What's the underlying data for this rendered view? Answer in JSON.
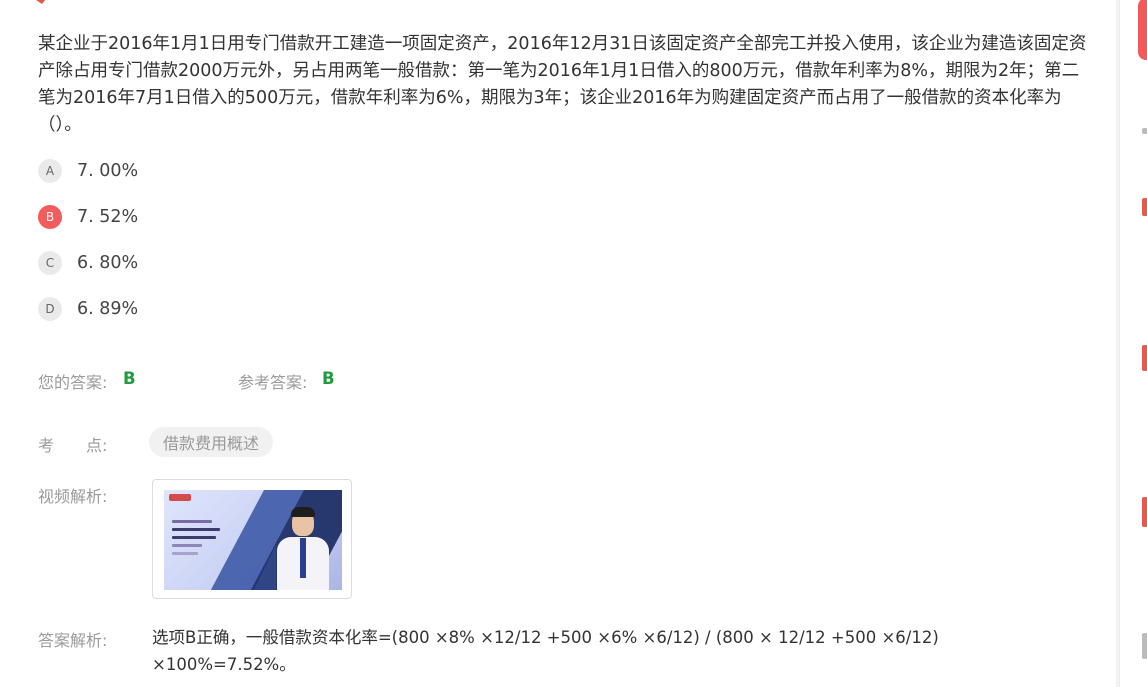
{
  "question": {
    "text": "某企业于2016年1月1日用专门借款开工建造一项固定资产，2016年12月31日该固定资产全部完工并投入使用，该企业为建造该固定资产除占用专门借款2000万元外，另占用两笔一般借款：第一笔为2016年1月1日借入的800万元，借款年利率为8%，期限为2年；第二笔为2016年7月1日借入的500万元，借款年利率为6%，期限为3年；该企业2016年为购建固定资产而占用了一般借款的资本化率为（）。"
  },
  "options": [
    {
      "letter": "A",
      "text": "7. 00%",
      "selected": false
    },
    {
      "letter": "B",
      "text": "7. 52%",
      "selected": true
    },
    {
      "letter": "C",
      "text": "6. 80%",
      "selected": false
    },
    {
      "letter": "D",
      "text": "6. 89%",
      "selected": false
    }
  ],
  "answer": {
    "your_label": "您的答案:",
    "your_value": "B",
    "ref_label": "参考答案:",
    "ref_value": "B"
  },
  "knowledge": {
    "label": "考　　点:",
    "tag": "借款费用概述"
  },
  "video": {
    "label": "视频解析:"
  },
  "explanation": {
    "label": "答案解析:",
    "text": "选项B正确，一般借款资本化率=(800 ×8% ×12/12 +500 ×6% ×6/12) / (800 × 12/12 +500 ×6/12) ×100%=7.52%。"
  },
  "colors": {
    "accent_red": "#f25c5c",
    "answer_green": "#1f9a3f"
  }
}
